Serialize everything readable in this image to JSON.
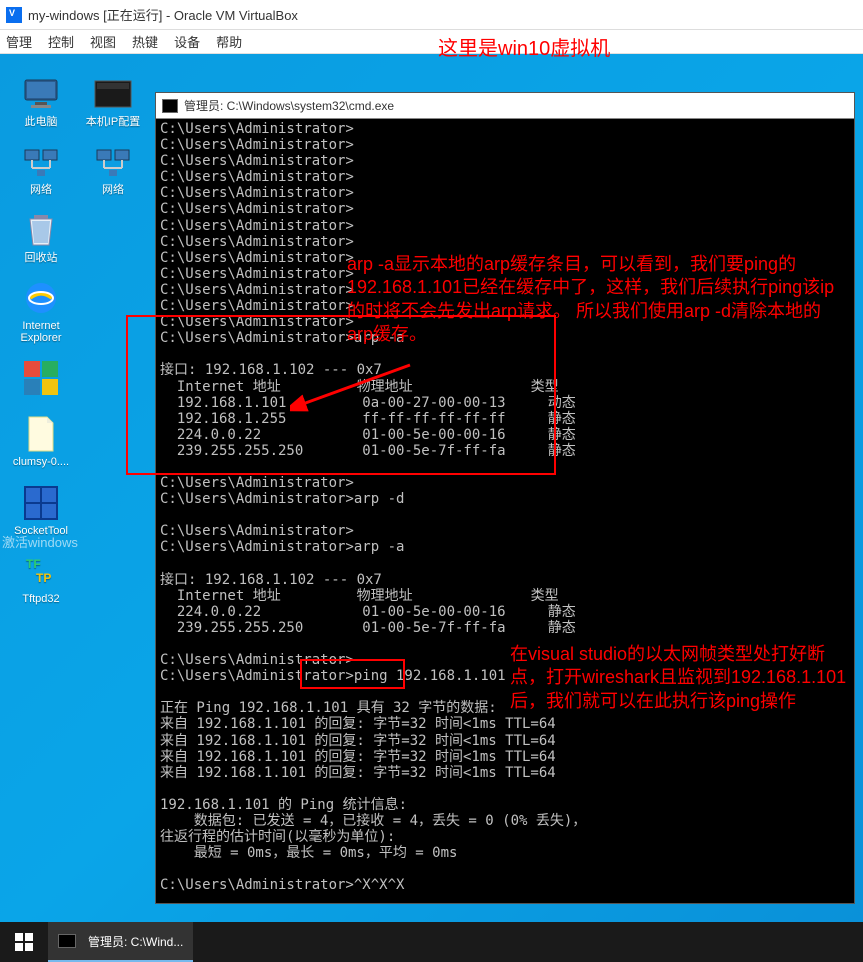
{
  "vbox": {
    "title": "my-windows [正在运行] - Oracle VM VirtualBox",
    "menu": [
      "管理",
      "控制",
      "视图",
      "热键",
      "设备",
      "帮助"
    ]
  },
  "annotations": {
    "top": "这里是win10虚拟机",
    "a1": "arp -a显示本地的arp缓存条目，可以看到，我们要ping的192.168.1.101已经在缓存中了，这样，我们后续执行ping该ip的时将不会先发出arp请求。   所以我们使用arp -d清除本地的arp缓存。",
    "a2": "在visual studio的以太网帧类型处打好断点，打开wireshark且监视到192.168.1.101后，我们就可以在此执行该ping操作"
  },
  "desktop_icons_col1": [
    {
      "label": "此电脑",
      "glyph": "pc"
    },
    {
      "label": "网络",
      "glyph": "net"
    },
    {
      "label": "回收站",
      "glyph": "bin"
    },
    {
      "label": "Internet Explorer",
      "glyph": "ie"
    },
    {
      "label": "",
      "glyph": "tiles"
    },
    {
      "label": "clumsy-0....",
      "glyph": "file"
    },
    {
      "label": "SocketTool",
      "glyph": "wintile"
    },
    {
      "label": "Tftpd32",
      "glyph": "tftp"
    }
  ],
  "desktop_icons_col2": [
    {
      "label": "本机IP配置",
      "glyph": "bat"
    },
    {
      "label": "网络",
      "glyph": "net"
    }
  ],
  "activate": "激活windows",
  "cmd": {
    "title": "管理员: C:\\Windows\\system32\\cmd.exe",
    "lines": [
      "C:\\Users\\Administrator>",
      "C:\\Users\\Administrator>",
      "C:\\Users\\Administrator>",
      "C:\\Users\\Administrator>",
      "C:\\Users\\Administrator>",
      "C:\\Users\\Administrator>",
      "C:\\Users\\Administrator>",
      "C:\\Users\\Administrator>",
      "C:\\Users\\Administrator>",
      "C:\\Users\\Administrator>",
      "C:\\Users\\Administrator>",
      "C:\\Users\\Administrator>",
      "C:\\Users\\Administrator>",
      "C:\\Users\\Administrator>arp -a",
      "",
      "接口: 192.168.1.102 --- 0x7",
      "  Internet 地址         物理地址              类型",
      "  192.168.1.101         0a-00-27-00-00-13     动态",
      "  192.168.1.255         ff-ff-ff-ff-ff-ff     静态",
      "  224.0.0.22            01-00-5e-00-00-16     静态",
      "  239.255.255.250       01-00-5e-7f-ff-fa     静态",
      "",
      "C:\\Users\\Administrator>",
      "C:\\Users\\Administrator>arp -d",
      "",
      "C:\\Users\\Administrator>",
      "C:\\Users\\Administrator>arp -a",
      "",
      "接口: 192.168.1.102 --- 0x7",
      "  Internet 地址         物理地址              类型",
      "  224.0.0.22            01-00-5e-00-00-16     静态",
      "  239.255.255.250       01-00-5e-7f-ff-fa     静态",
      "",
      "C:\\Users\\Administrator>",
      "C:\\Users\\Administrator>ping 192.168.1.101",
      "",
      "正在 Ping 192.168.1.101 具有 32 字节的数据:",
      "来自 192.168.1.101 的回复: 字节=32 时间<1ms TTL=64",
      "来自 192.168.1.101 的回复: 字节=32 时间<1ms TTL=64",
      "来自 192.168.1.101 的回复: 字节=32 时间<1ms TTL=64",
      "来自 192.168.1.101 的回复: 字节=32 时间<1ms TTL=64",
      "",
      "192.168.1.101 的 Ping 统计信息:",
      "    数据包: 已发送 = 4，已接收 = 4，丢失 = 0 (0% 丢失)，",
      "往返行程的估计时间(以毫秒为单位):",
      "    最短 = 0ms，最长 = 0ms，平均 = 0ms",
      "",
      "C:\\Users\\Administrator>^X^X^X"
    ]
  },
  "taskbar": {
    "item": "管理员: C:\\Wind..."
  }
}
